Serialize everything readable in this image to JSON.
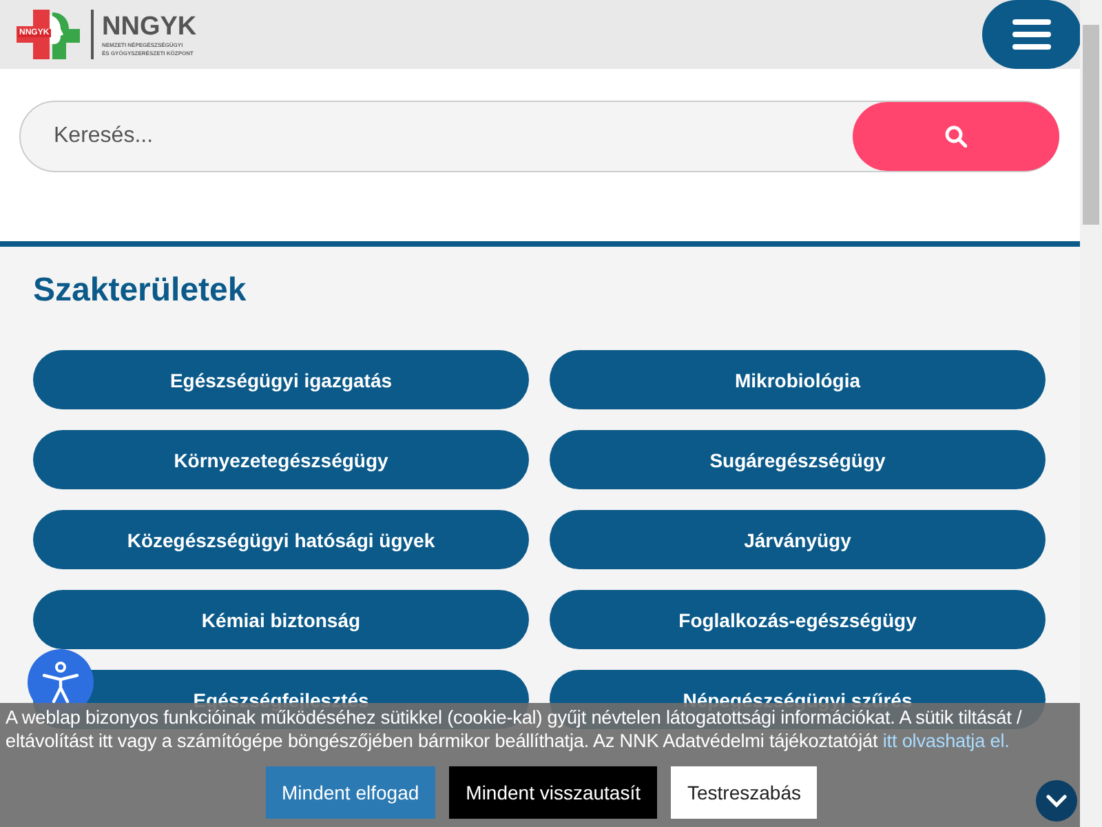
{
  "header": {
    "logo": {
      "badge": "NNGYK",
      "name": "NNGYK",
      "subtitle_1": "NEMZETI NÉPEGÉSZSÉGÜGYI",
      "subtitle_2": "ÉS GYÓGYSZERÉSZETI KÖZPONT"
    }
  },
  "search": {
    "placeholder": "Keresés..."
  },
  "section": {
    "title": "Szakterületek",
    "items": [
      {
        "label": "Egészségügyi igazgatás"
      },
      {
        "label": "Mikrobiológia"
      },
      {
        "label": "Környezetegészségügy"
      },
      {
        "label": "Sugáregészségügy"
      },
      {
        "label": "Közegészségügyi hatósági ügyek"
      },
      {
        "label": "Járványügy"
      },
      {
        "label": "Kémiai biztonság"
      },
      {
        "label": "Foglalkozás-egészségügy"
      },
      {
        "label": "Egészségfejlesztés"
      },
      {
        "label": "Népegészségügyi szűrés"
      }
    ]
  },
  "cookie_banner": {
    "text": "A weblap bizonyos funkcióinak működéséhez sütikkel (cookie-kal) gyűjt névtelen látogatottsági információkat. A sütik tiltását / eltávolítást itt vagy a számítógépe böngészőjében bármikor beállíthatja. Az NNK Adatvédelmi tájékoztatóját",
    "link": "itt olvashatja el.",
    "buttons": [
      {
        "label": "Mindent elfogad",
        "kind": "accept"
      },
      {
        "label": "Mindent visszautasít",
        "kind": "reject"
      },
      {
        "label": "Testreszabás",
        "kind": "customize"
      }
    ]
  }
}
